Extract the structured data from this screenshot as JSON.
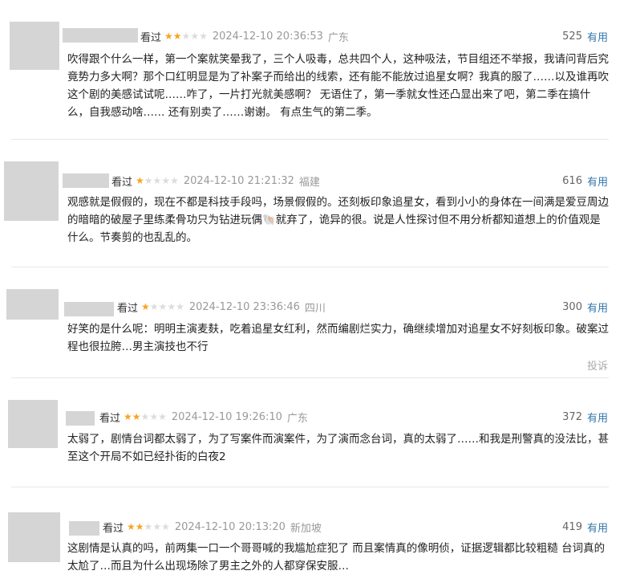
{
  "colors": {
    "star_on": "#f5a623",
    "star_off": "#dcdcdc",
    "link": "#3377aa",
    "meta": "#999999"
  },
  "reviews": [
    {
      "watched": "看过",
      "rating": 2,
      "time": "2024-12-10 20:36:53",
      "location": "广东",
      "votes": "525",
      "useful_label": "有用",
      "content": "吹得跟个什么一样，第一个案就笑晕我了，三个人吸毒，总共四个人，这种吸法，节目组还不举报，我请问背后究竟势力多大啊？那个口红明显是为了补案子而给出的线索，还有能不能放过追星女啊？我真的服了……以及谁再吹这个剧的美感试试呢……咋了，一片打光就美感啊？ 无语住了，第一季就女性还凸显出来了吧，第二季在搞什么，自我感动啥…… 还有别卖了……谢谢。 有点生气的第二季。"
    },
    {
      "watched": "看过",
      "rating": 1,
      "time": "2024-12-10 21:21:32",
      "location": "福建",
      "votes": "616",
      "useful_label": "有用",
      "content": "观感就是假假的，现在不都是科技手段吗，场景假假的。还刻板印象追星女，看到小小的身体在一间满是爱豆周边的暗暗的破屋子里练柔骨功只为钻进玩偶🐚就弃了，诡异的很。说是人性探讨但不用分析都知道想上的价值观是什么。节奏剪的也乱乱的。"
    },
    {
      "watched": "看过",
      "rating": 1,
      "time": "2024-12-10 23:36:46",
      "location": "四川",
      "votes": "300",
      "useful_label": "有用",
      "content": "好笑的是什么呢：明明主演麦麸，吃着追星女红利，然而编剧烂实力，确继续增加对追星女不好刻板印象。破案过程也很拉胯…男主演技也不行",
      "report_label": "投诉"
    },
    {
      "watched": "看过",
      "rating": 2,
      "time": "2024-12-10 19:26:10",
      "location": "广东",
      "votes": "372",
      "useful_label": "有用",
      "content": "太弱了，剧情台词都太弱了，为了写案件而演案件，为了演而念台词，真的太弱了……和我是刑警真的没法比，甚至这个开局不如已经扑街的白夜2"
    },
    {
      "watched": "看过",
      "rating": 2,
      "time": "2024-12-10 20:13:20",
      "location": "新加坡",
      "votes": "419",
      "useful_label": "有用",
      "content": "这剧情是认真的吗，前两集一口一个哥哥喊的我尴尬症犯了 而且案情真的像明侦，证据逻辑都比较粗糙 台词真的太尬了…而且为什么出现场除了男主之外的人都穿保安服…"
    }
  ]
}
